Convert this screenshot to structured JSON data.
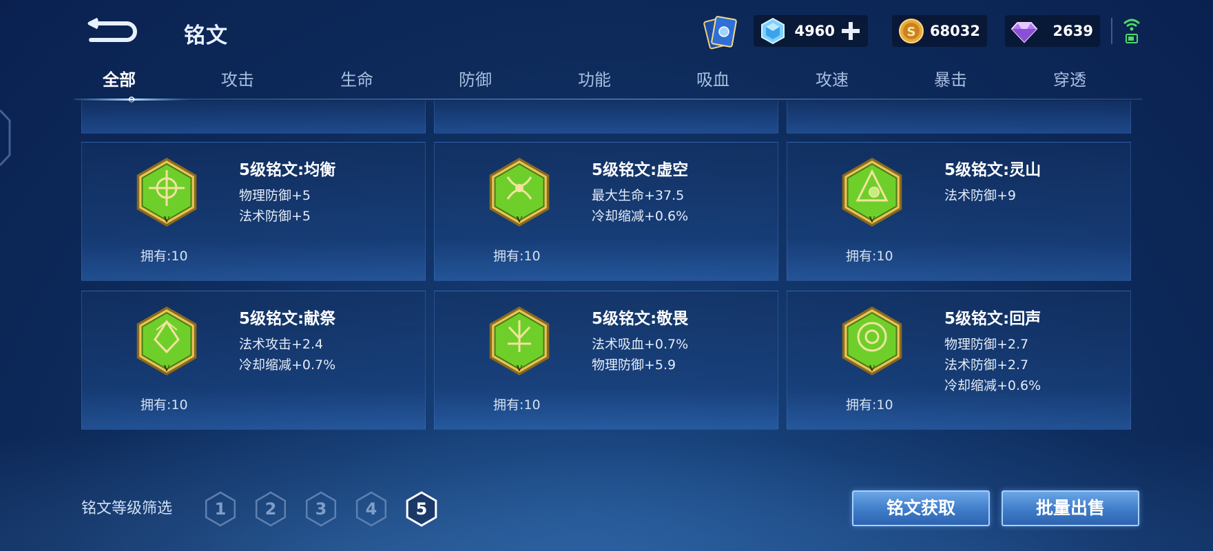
{
  "header": {
    "title": "铭文",
    "resources": {
      "gem": {
        "value": "4960",
        "icon": "crystal-gem-icon"
      },
      "coin": {
        "value": "68032",
        "icon": "gold-coin-icon"
      },
      "diamond": {
        "value": "2639",
        "icon": "purple-diamond-icon"
      }
    }
  },
  "tabs": [
    {
      "label": "全部",
      "active": true
    },
    {
      "label": "攻击"
    },
    {
      "label": "生命"
    },
    {
      "label": "防御"
    },
    {
      "label": "功能"
    },
    {
      "label": "吸血"
    },
    {
      "label": "攻速"
    },
    {
      "label": "暴击"
    },
    {
      "label": "穿透"
    }
  ],
  "cards": [
    {
      "name": "5级铭文:均衡",
      "stats": [
        "物理防御+5",
        "法术防御+5"
      ],
      "owned": "拥有:10",
      "color": "#6fcf2a"
    },
    {
      "name": "5级铭文:虚空",
      "stats": [
        "最大生命+37.5",
        "冷却缩减+0.6%"
      ],
      "owned": "拥有:10",
      "color": "#6fcf2a"
    },
    {
      "name": "5级铭文:灵山",
      "stats": [
        "法术防御+9"
      ],
      "owned": "拥有:10",
      "color": "#6fcf2a"
    },
    {
      "name": "5级铭文:献祭",
      "stats": [
        "法术攻击+2.4",
        "冷却缩减+0.7%"
      ],
      "owned": "拥有:10",
      "color": "#6fcf2a"
    },
    {
      "name": "5级铭文:敬畏",
      "stats": [
        "法术吸血+0.7%",
        "物理防御+5.9"
      ],
      "owned": "拥有:10",
      "color": "#6fcf2a"
    },
    {
      "name": "5级铭文:回声",
      "stats": [
        "物理防御+2.7",
        "法术防御+2.7",
        "冷却缩减+0.6%"
      ],
      "owned": "拥有:10",
      "color": "#6fcf2a"
    }
  ],
  "emblem_mark": "V",
  "filter": {
    "label": "铭文等级筛选",
    "levels": [
      "1",
      "2",
      "3",
      "4",
      "5"
    ],
    "selected": "5"
  },
  "buttons": {
    "acquire": "铭文获取",
    "bulk_sell": "批量出售"
  }
}
